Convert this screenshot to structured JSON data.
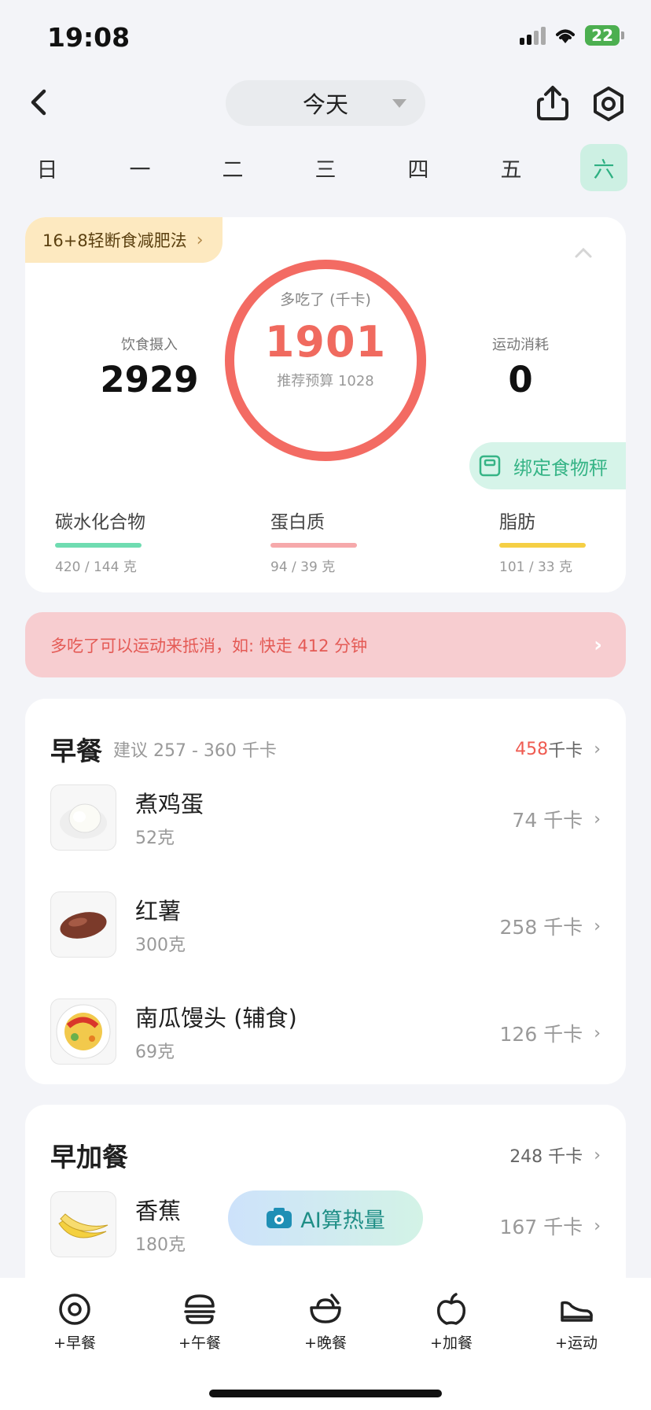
{
  "status_bar": {
    "time": "19:08",
    "battery": "22"
  },
  "header": {
    "day_select_label": "今天"
  },
  "week": [
    "日",
    "一",
    "二",
    "三",
    "四",
    "五",
    "六"
  ],
  "summary": {
    "plan_chip": "16+8轻断食减肥法",
    "intake_label": "饮食摄入",
    "intake_value": "2929",
    "ring_label": "多吃了 (千卡)",
    "ring_value": "1901",
    "ring_sub": "推荐预算 1028",
    "burn_label": "运动消耗",
    "burn_value": "0",
    "scale_button": "绑定食物秤",
    "macros": [
      {
        "name": "碳水化合物",
        "amount": "420 / 144 克",
        "color": "#6fdcb1"
      },
      {
        "name": "蛋白质",
        "amount": "94 / 39 克",
        "color": "#f6a9ab"
      },
      {
        "name": "脂肪",
        "amount": "101 / 33 克",
        "color": "#f5cf45"
      }
    ],
    "colors": {
      "ring": "#f36b63",
      "accent": "#36b486"
    }
  },
  "banner": {
    "text": "多吃了可以运动来抵消，如: 快走 412 分钟"
  },
  "breakfast": {
    "title": "早餐",
    "hint": "建议 257 - 360 千卡",
    "total_value": "458",
    "total_unit": "千卡",
    "items": [
      {
        "name": "煮鸡蛋",
        "weight": "52克",
        "kcal": "74 千卡"
      },
      {
        "name": "红薯",
        "weight": "300克",
        "kcal": "258 千卡"
      },
      {
        "name": "南瓜馒头 (辅食)",
        "weight": "69克",
        "kcal": "126 千卡"
      }
    ]
  },
  "snack": {
    "title": "早加餐",
    "total": "248 千卡",
    "items": [
      {
        "name": "香蕉",
        "weight": "180克",
        "kcal": "167 千卡"
      }
    ]
  },
  "ai_button": "AI算热量",
  "bottom_tabs": [
    "+早餐",
    "+午餐",
    "+晚餐",
    "+加餐",
    "+运动"
  ]
}
